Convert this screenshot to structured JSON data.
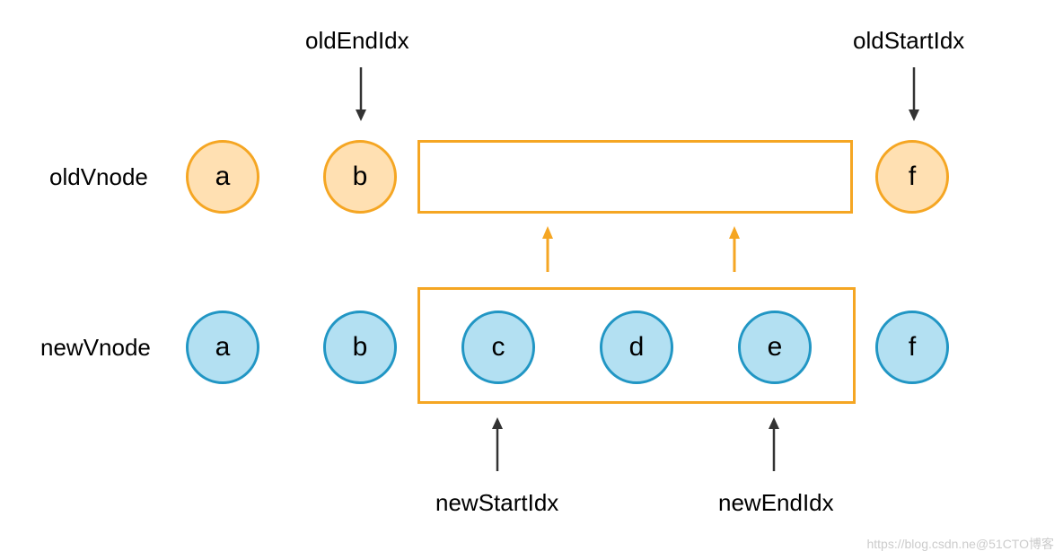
{
  "labels": {
    "oldEndIdx": "oldEndIdx",
    "oldStartIdx": "oldStartIdx",
    "oldVnode": "oldVnode",
    "newVnode": "newVnode",
    "newStartIdx": "newStartIdx",
    "newEndIdx": "newEndIdx"
  },
  "oldNodes": {
    "a": "a",
    "b": "b",
    "f": "f"
  },
  "newNodes": {
    "a": "a",
    "b": "b",
    "c": "c",
    "d": "d",
    "e": "e",
    "f": "f"
  },
  "watermark": {
    "left": "https://blog.csdn.ne",
    "right": "@51CTO博客"
  },
  "colors": {
    "oldFill": "#ffe0b2",
    "oldStroke": "#f5a623",
    "newFill": "#b3e0f2",
    "newStroke": "#2196c4",
    "orange": "#f5a623"
  }
}
